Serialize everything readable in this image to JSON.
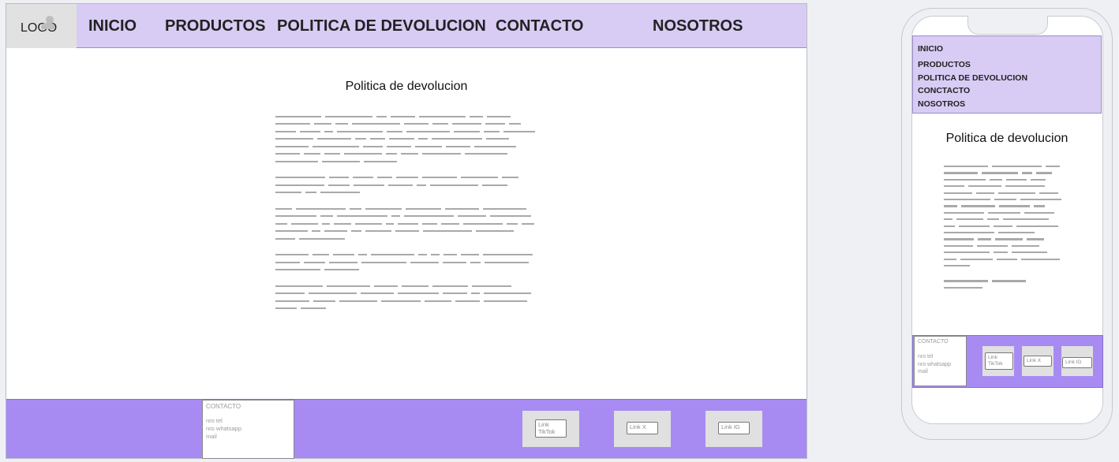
{
  "nav": {
    "logo": "LOGO",
    "items": [
      "INICIO",
      "PRODUCTOS",
      "POLITICA DE DEVOLUCION",
      "CONTACTO",
      "NOSOTROS"
    ]
  },
  "main": {
    "title": "Politica de devolucion"
  },
  "footer": {
    "contact_title": "CONTACTO",
    "contact_lines": [
      "nro tel",
      "nro whatsapp",
      "mail"
    ],
    "links": [
      "Link TikTok",
      "Link X",
      "Link IG"
    ]
  },
  "mobile": {
    "nav_items": [
      "INICIO",
      "PRODUCTOS",
      "POLITICA DE DEVOLUCION",
      "CONCTACTO",
      "NOSOTROS"
    ],
    "title": "Politica de devolucion",
    "contact_title": "CONTACTO",
    "contact_lines": [
      "nro tel",
      "nro whatsapp",
      "mail"
    ],
    "links": [
      "Link TikTok",
      "Link X",
      "Link IG"
    ]
  },
  "colors": {
    "nav_bg": "#d8ccf5",
    "footer_bg": "#a78bf2",
    "placeholder_text": "#a9a9a9"
  },
  "icons": {
    "logo_image": "image-placeholder-icon"
  }
}
